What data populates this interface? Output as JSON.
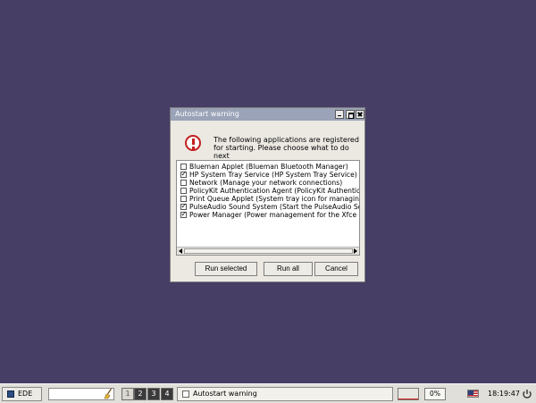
{
  "dialog": {
    "title": "Autostart warning",
    "icon": "exclamation-icon",
    "message": "The following applications are registered\nfor starting. Please choose what to do next",
    "items": [
      {
        "label": "Blueman Applet (Blueman Bluetooth Manager)",
        "checked": false
      },
      {
        "label": "HP System Tray Service (HP System Tray Service)",
        "checked": true
      },
      {
        "label": "Network (Manage your network connections)",
        "checked": false
      },
      {
        "label": "PolicyKit Authentication Agent (PolicyKit Authenticati",
        "checked": false
      },
      {
        "label": "Print Queue Applet (System tray icon for managing p",
        "checked": false
      },
      {
        "label": "PulseAudio Sound System (Start the PulseAudio Sou",
        "checked": true
      },
      {
        "label": "Power Manager (Power management for the Xfce de",
        "checked": true
      }
    ],
    "buttons": {
      "run_selected": "Run selected",
      "run_all": "Run all",
      "cancel": "Cancel"
    }
  },
  "taskbar": {
    "start_label": "EDE",
    "workspaces": [
      "1",
      "2",
      "3",
      "4"
    ],
    "active_workspace": "1",
    "task_label": "Autostart warning",
    "battery": "0%",
    "clock": "18:19:47",
    "colors": {
      "desktop": "#473e66",
      "titlebar": "#9aa3b7",
      "warning": "#c22020"
    }
  }
}
